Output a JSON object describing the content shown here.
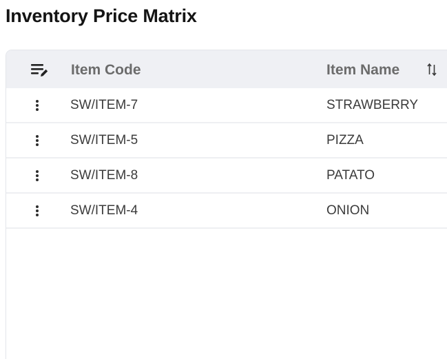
{
  "page": {
    "title": "Inventory Price Matrix"
  },
  "table": {
    "columns": {
      "actions_icon": "edit-columns-icon",
      "item_code": "Item Code",
      "item_name": "Item Name",
      "sort_icon": "sort-arrows-icon"
    },
    "rows": [
      {
        "item_code": "SW/ITEM-7",
        "item_name": "STRAWBERRY"
      },
      {
        "item_code": "SW/ITEM-5",
        "item_name": "PIZZA"
      },
      {
        "item_code": "SW/ITEM-8",
        "item_name": "PATATO"
      },
      {
        "item_code": "SW/ITEM-4",
        "item_name": "ONION"
      }
    ],
    "row_menu_icon": "more-vertical-icon"
  },
  "colors": {
    "header_background": "#eff0f4",
    "header_text": "#6b6b6b",
    "title_text": "#141414",
    "cell_text": "#3b3b3b",
    "row_divider": "#eeeff2"
  }
}
